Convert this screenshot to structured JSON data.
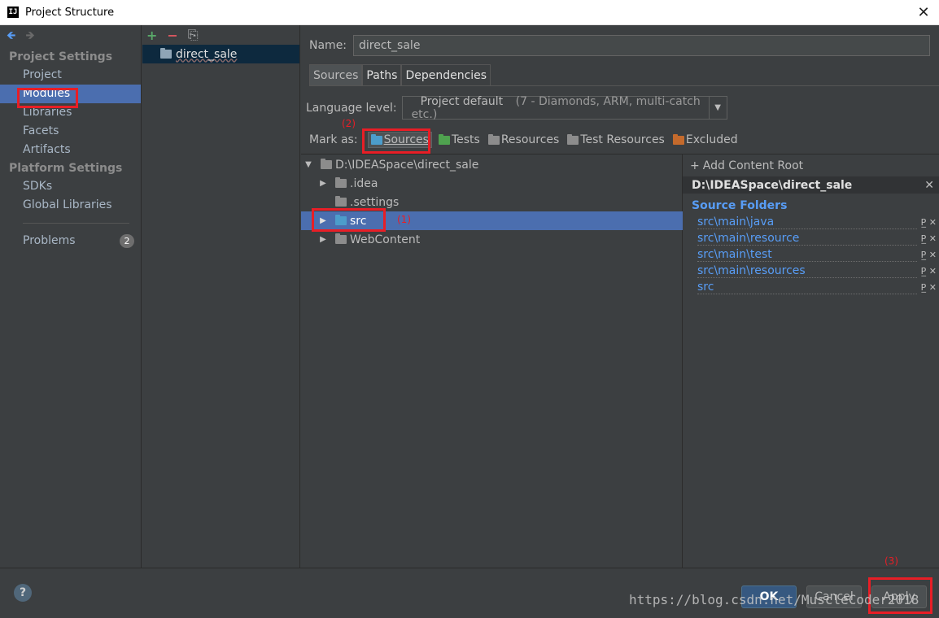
{
  "window": {
    "title": "Project Structure",
    "close": "✕",
    "app_icon": "IJ"
  },
  "nav": {
    "back_icon": "🡸",
    "forward_icon": "🡺",
    "section_project": "Project Settings",
    "project_items": [
      "Project",
      "Modules",
      "Libraries",
      "Facets",
      "Artifacts"
    ],
    "section_platform": "Platform Settings",
    "platform_items": [
      "SDKs",
      "Global Libraries"
    ],
    "problems_label": "Problems",
    "problems_count": "2"
  },
  "modules": {
    "add_icon": "+",
    "remove_icon": "−",
    "copy_icon": "⎘",
    "items": [
      "direct_sale"
    ]
  },
  "module": {
    "name_label": "Name:",
    "name_value": "direct_sale",
    "tabs": [
      "Sources",
      "Paths",
      "Dependencies"
    ],
    "language_label": "Language level:",
    "language_value": "Project default",
    "language_detail": " (7 - Diamonds, ARM, multi-catch etc.)",
    "mark_as_label": "Mark as:",
    "mark_buttons": [
      {
        "label": "Sources",
        "color": "#4c9dcb"
      },
      {
        "label": "Tests",
        "color": "#4fa24f"
      },
      {
        "label": "Resources",
        "color": "#8c8c8c"
      },
      {
        "label": "Test Resources",
        "color": "#8c8c8c"
      },
      {
        "label": "Excluded",
        "color": "#c46a2c"
      }
    ]
  },
  "tree": {
    "root": "D:\\IDEASpace\\direct_sale",
    "children": [
      ".idea",
      ".settings",
      "src",
      "WebContent"
    ]
  },
  "content_root": {
    "add_label": "Add Content Root",
    "path": "D:\\IDEASpace\\direct_sale",
    "source_folders_title": "Source Folders",
    "source_folders": [
      "src\\main\\java",
      "src\\main\\resource",
      "src\\main\\test",
      "src\\main\\resources",
      "src"
    ],
    "item_actions": "P̲ ✕"
  },
  "buttons": {
    "help": "?",
    "ok": "OK",
    "cancel": "Cancel",
    "apply": "Apply"
  },
  "annotations": {
    "step1": "(1)",
    "step2": "(2)",
    "step3": "(3)"
  },
  "watermark": "https://blog.csdn.net/MuscleCoder2018"
}
